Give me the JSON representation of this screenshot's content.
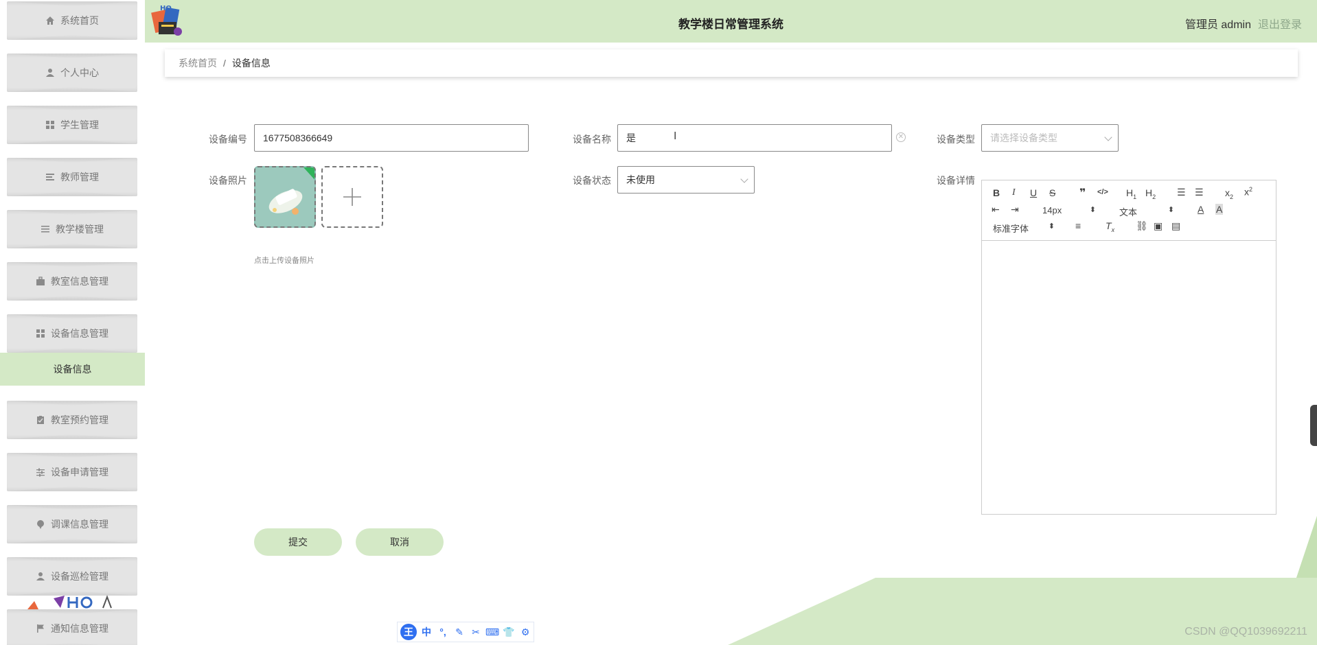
{
  "app": {
    "title": "教学楼日常管理系统",
    "user_label": "管理员 admin",
    "logout_label": "退出登录"
  },
  "sidebar": {
    "items": [
      {
        "label": "系统首页",
        "icon": "home-icon"
      },
      {
        "label": "个人中心",
        "icon": "user-icon"
      },
      {
        "label": "学生管理",
        "icon": "grid-icon"
      },
      {
        "label": "教师管理",
        "icon": "list-icon"
      },
      {
        "label": "教学楼管理",
        "icon": "menu-icon"
      },
      {
        "label": "教室信息管理",
        "icon": "briefcase-icon"
      },
      {
        "label": "设备信息管理",
        "icon": "grid-icon"
      },
      {
        "label": "教室预约管理",
        "icon": "clipboard-icon"
      },
      {
        "label": "设备申请管理",
        "icon": "sliders-icon"
      },
      {
        "label": "调课信息管理",
        "icon": "pin-icon"
      },
      {
        "label": "设备巡检管理",
        "icon": "user-icon"
      },
      {
        "label": "通知信息管理",
        "icon": "flag-icon"
      }
    ],
    "active_sub": "设备信息"
  },
  "breadcrumb": {
    "home": "系统首页",
    "separator": "/",
    "current": "设备信息"
  },
  "form": {
    "device_no": {
      "label": "设备编号",
      "value": "1677508366649"
    },
    "device_name": {
      "label": "设备名称",
      "value": "是"
    },
    "device_type": {
      "label": "设备类型",
      "placeholder": "请选择设备类型"
    },
    "device_photo": {
      "label": "设备照片",
      "tip": "点击上传设备照片"
    },
    "device_status": {
      "label": "设备状态",
      "value": "未使用"
    },
    "device_detail": {
      "label": "设备详情"
    }
  },
  "editor": {
    "font_size": "14px",
    "paragraph": "文本",
    "font_family": "标准字体"
  },
  "buttons": {
    "submit": "提交",
    "cancel": "取消"
  },
  "ime": {
    "badge": "王",
    "lang": "中"
  },
  "watermark": "CSDN @QQ1039692211",
  "colors": {
    "header_bg": "#d4e9c6",
    "sidebar_item_bg": "#e4e4e4",
    "accent_green": "#d4e9c6",
    "logout": "#8ea78b",
    "ime_blue": "#2f6ff0"
  }
}
